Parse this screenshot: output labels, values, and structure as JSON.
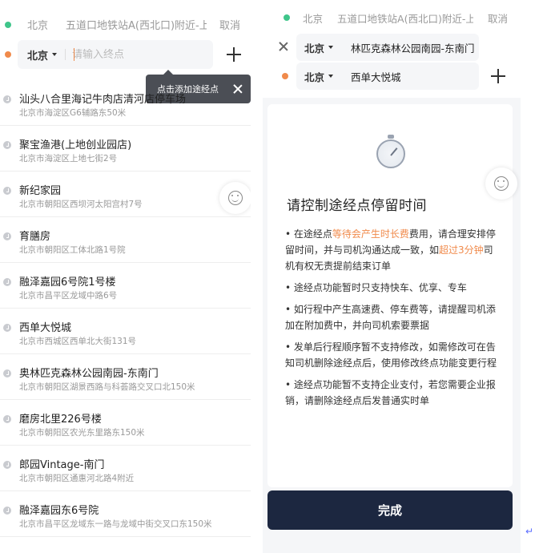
{
  "left": {
    "start": {
      "city": "北京",
      "address": "五道口地铁站A(西北口)附近-上",
      "cancel": "取消"
    },
    "end": {
      "city": "北京",
      "placeholder": "请输入终点"
    },
    "tooltip": "点击添加途经点",
    "history": [
      {
        "name": "汕头八合里海记牛肉店清河店停车场",
        "address": "北京市海淀区G6辅路东50米"
      },
      {
        "name": "聚宝渔港(上地创业园店)",
        "address": "北京市海淀区上地七街2号"
      },
      {
        "name": "新纪家园",
        "address": "北京市朝阳区西坝河太阳宫村7号"
      },
      {
        "name": "育膳房",
        "address": "北京市朝阳区工体北路1号院"
      },
      {
        "name": "融泽嘉园6号院1号楼",
        "address": "北京市昌平区龙域中路6号"
      },
      {
        "name": "西单大悦城",
        "address": "北京市西城区西单北大街131号"
      },
      {
        "name": "奥林匹克森林公园南园-东南门",
        "address": "北京市朝阳区湖景西路与科荟路交叉口北150米"
      },
      {
        "name": "磨房北里226号楼",
        "address": "北京市朝阳区农光东里路东150米"
      },
      {
        "name": "郎园Vintage-南门",
        "address": "北京市朝阳区通惠河北路4附近"
      },
      {
        "name": "融泽嘉园东6号院",
        "address": "北京市昌平区龙域东一路与龙域中街交叉口东150米"
      }
    ]
  },
  "right": {
    "start": {
      "city": "北京",
      "address": "五道口地铁站A(西北口)附近-上",
      "cancel": "取消"
    },
    "waypoint": {
      "city": "北京",
      "value": "林匹克森林公园南园-东南门"
    },
    "end": {
      "city": "北京",
      "value": "西单大悦城"
    },
    "card": {
      "title": "请控制途经点停留时间",
      "rule1": {
        "bullet": "• 在途经点",
        "hl1": "等待会产生时长费",
        "mid": "费用，请合理安排停留时间，并与司机沟通达成一致，如",
        "hl2": "超过3分钟",
        "tail": "司机有权无责提前结束订单"
      },
      "rule2": "• 途经点功能暂时只支持快车、优享、专车",
      "rule3": "• 如行程中产生高速费、停车费等，请提醒司机添加在附加费中，并向司机索要票据",
      "rule4": "• 发单后行程顺序暂不支持修改，如需修改可在告知司机删除途经点后，使用修改终点功能变更行程",
      "rule5": "• 途经点功能暂不支持企业支付，若您需要企业报销，请删除途经点后发普通实时单"
    },
    "done_button": "完成"
  },
  "return_glyph": "↵",
  "colors": {
    "accent": "#f08a4b",
    "start_dot": "#3fc58a",
    "button": "#1c2740"
  }
}
